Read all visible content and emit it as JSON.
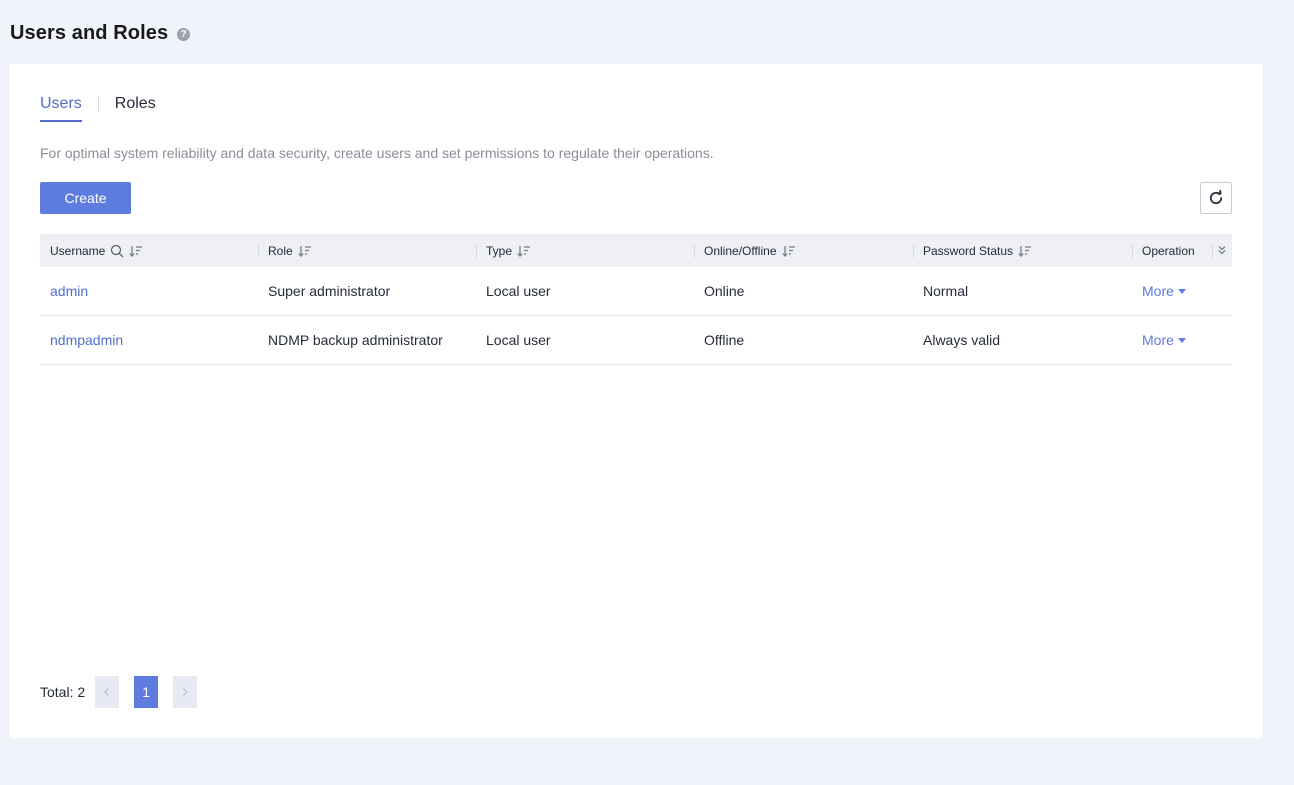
{
  "page": {
    "title": "Users and Roles",
    "help_glyph": "?"
  },
  "tabs": [
    {
      "label": "Users",
      "active": true
    },
    {
      "label": "Roles",
      "active": false
    }
  ],
  "intro": "For optimal system reliability and data security, create users and set permissions to regulate their operations.",
  "toolbar": {
    "create_label": "Create"
  },
  "table": {
    "columns": [
      "Username",
      "Role",
      "Type",
      "Online/Offline",
      "Password Status",
      "Operation"
    ],
    "rows": [
      {
        "username": "admin",
        "role": "Super administrator",
        "type": "Local user",
        "status": "Online",
        "password_status": "Normal",
        "operation": "More"
      },
      {
        "username": "ndmpadmin",
        "role": "NDMP backup administrator",
        "type": "Local user",
        "status": "Offline",
        "password_status": "Always valid",
        "operation": "More"
      }
    ]
  },
  "pagination": {
    "total_label": "Total: 2",
    "current_page": "1"
  },
  "colors": {
    "accent": "#5e7ce0",
    "link": "#526ecc",
    "page_bg": "#f0f3f9"
  }
}
